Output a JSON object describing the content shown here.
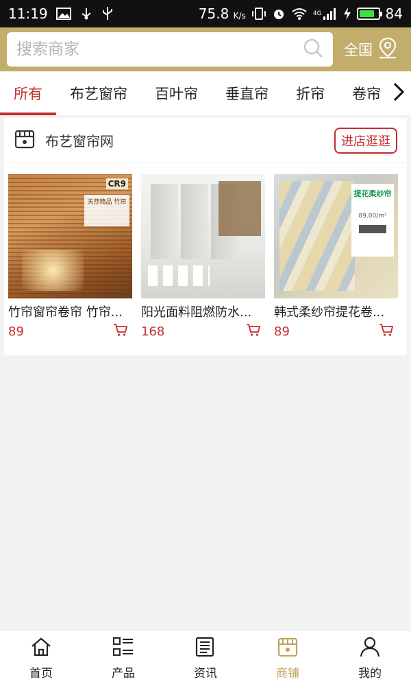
{
  "status_bar": {
    "time": "11:19",
    "net_speed": "75.8",
    "net_speed_unit": "K/s",
    "network_type": "4G",
    "battery_percent": "84",
    "battery_level": 0.84,
    "icons": [
      "image-icon",
      "usb-icon",
      "vibrate-icon",
      "alarm-icon",
      "wifi-icon",
      "signal-icon",
      "charging-icon",
      "battery-icon"
    ]
  },
  "header": {
    "search_placeholder": "搜索商家",
    "region_label": "全国",
    "accent_color": "#c2ad6b"
  },
  "tabs": {
    "items": [
      {
        "label": "所有",
        "active": true
      },
      {
        "label": "布艺窗帘",
        "active": false
      },
      {
        "label": "百叶帘",
        "active": false
      },
      {
        "label": "垂直帘",
        "active": false
      },
      {
        "label": "折帘",
        "active": false
      },
      {
        "label": "卷帘",
        "active": false
      }
    ],
    "active_color": "#c62d2d"
  },
  "store": {
    "name": "布艺窗帘网",
    "visit_button": "进店逛逛",
    "products": [
      {
        "title": "竹帘窗帘卷帘 竹帘...",
        "price": "89",
        "image_text": "天然精品 竹帘",
        "image_logo": "CR9"
      },
      {
        "title": "阳光面料阻燃防水...",
        "price": "168"
      },
      {
        "title": "韩式柔纱帘提花卷...",
        "price": "89",
        "image_text": "提花柔纱帘",
        "image_price": "89.00/m²"
      }
    ]
  },
  "bottom_nav": {
    "items": [
      {
        "label": "首页",
        "icon": "home-icon",
        "active": false
      },
      {
        "label": "产品",
        "icon": "product-grid-icon",
        "active": false
      },
      {
        "label": "资讯",
        "icon": "news-icon",
        "active": false
      },
      {
        "label": "商铺",
        "icon": "store-icon",
        "active": true
      },
      {
        "label": "我的",
        "icon": "user-icon",
        "active": false
      }
    ],
    "active_color": "#c2a25e"
  }
}
